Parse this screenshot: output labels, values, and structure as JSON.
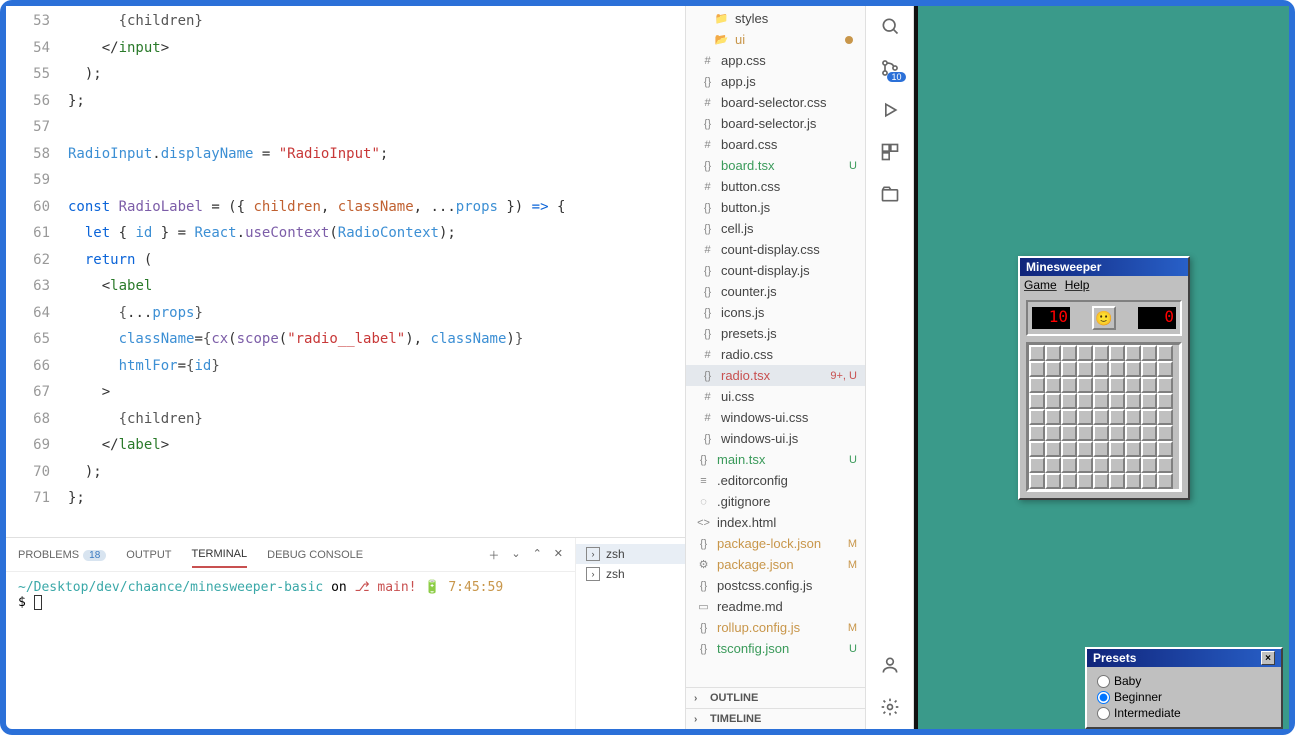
{
  "code": {
    "lines": [
      {
        "n": 53,
        "html": "      <span class='punc'>{children}</span>"
      },
      {
        "n": 54,
        "html": "    &lt;/<span class='tag'>input</span>&gt;"
      },
      {
        "n": 55,
        "html": "  );"
      },
      {
        "n": 56,
        "html": "};"
      },
      {
        "n": 57,
        "html": ""
      },
      {
        "n": 58,
        "html": "<span class='prop'>RadioInput</span>.<span class='prop'>displayName</span> = <span class='str'>\"RadioInput\"</span>;"
      },
      {
        "n": 59,
        "html": ""
      },
      {
        "n": 60,
        "html": "<span class='kw'>const</span> <span class='fn'>RadioLabel</span> = ({ <span class='param'>children</span>, <span class='param'>className</span>, ...<span class='prop'>props</span> }) <span class='kw'>=&gt;</span> {"
      },
      {
        "n": 61,
        "html": "  <span class='kw'>let</span> { <span class='prop'>id</span> } = <span class='prop'>React</span>.<span class='fn'>useContext</span>(<span class='prop'>RadioContext</span>);"
      },
      {
        "n": 62,
        "html": "  <span class='kw'>return</span> ("
      },
      {
        "n": 63,
        "html": "    &lt;<span class='tag'>label</span>"
      },
      {
        "n": 64,
        "html": "      <span class='punc'>{</span>...<span class='prop'>props</span><span class='punc'>}</span>"
      },
      {
        "n": 65,
        "html": "      <span class='prop'>className</span>=<span class='punc'>{</span><span class='fn'>cx</span>(<span class='fn'>scope</span>(<span class='str'>\"radio__label\"</span>), <span class='prop'>className</span>)<span class='punc'>}</span>"
      },
      {
        "n": 66,
        "html": "      <span class='prop'>htmlFor</span>=<span class='punc'>{</span><span class='prop'>id</span><span class='punc'>}</span>"
      },
      {
        "n": 67,
        "html": "    &gt;"
      },
      {
        "n": 68,
        "html": "      <span class='punc'>{children}</span>"
      },
      {
        "n": 69,
        "html": "    &lt;/<span class='tag'>label</span>&gt;"
      },
      {
        "n": 70,
        "html": "  );"
      },
      {
        "n": 71,
        "html": "};"
      }
    ]
  },
  "panel": {
    "tabs": {
      "problems": "PROBLEMS",
      "problems_count": "18",
      "output": "OUTPUT",
      "terminal": "TERMINAL",
      "debug": "DEBUG CONSOLE"
    },
    "terminal": {
      "path": "~/Desktop/dev/chaance/minesweeper-basic",
      "on": " on ",
      "branch": "⎇ main!",
      "battery": "🔋",
      "time": "7:45:59",
      "prompt": "$ "
    },
    "shells": [
      "zsh",
      "zsh"
    ]
  },
  "explorer": {
    "folders": {
      "styles": "styles",
      "ui": "ui"
    },
    "files": [
      {
        "name": "app.css",
        "icon": "#",
        "indent": 2
      },
      {
        "name": "app.js",
        "icon": "{}",
        "indent": 2
      },
      {
        "name": "board-selector.css",
        "icon": "#",
        "indent": 2
      },
      {
        "name": "board-selector.js",
        "icon": "{}",
        "indent": 2
      },
      {
        "name": "board.css",
        "icon": "#",
        "indent": 2
      },
      {
        "name": "board.tsx",
        "icon": "{}",
        "indent": 2,
        "cls": "green",
        "badge": "U"
      },
      {
        "name": "button.css",
        "icon": "#",
        "indent": 2
      },
      {
        "name": "button.js",
        "icon": "{}",
        "indent": 2
      },
      {
        "name": "cell.js",
        "icon": "{}",
        "indent": 2
      },
      {
        "name": "count-display.css",
        "icon": "#",
        "indent": 2
      },
      {
        "name": "count-display.js",
        "icon": "{}",
        "indent": 2
      },
      {
        "name": "counter.js",
        "icon": "{}",
        "indent": 2
      },
      {
        "name": "icons.js",
        "icon": "{}",
        "indent": 2
      },
      {
        "name": "presets.js",
        "icon": "{}",
        "indent": 2
      },
      {
        "name": "radio.css",
        "icon": "#",
        "indent": 2
      },
      {
        "name": "radio.tsx",
        "icon": "{}",
        "indent": 2,
        "cls": "red",
        "badge": "9+, U",
        "active": true
      },
      {
        "name": "ui.css",
        "icon": "#",
        "indent": 2
      },
      {
        "name": "windows-ui.css",
        "icon": "#",
        "indent": 2
      },
      {
        "name": "windows-ui.js",
        "icon": "{}",
        "indent": 2
      },
      {
        "name": "main.tsx",
        "icon": "{}",
        "indent": 1,
        "cls": "green",
        "badge": "U"
      },
      {
        "name": ".editorconfig",
        "icon": "≡",
        "indent": 1
      },
      {
        "name": ".gitignore",
        "icon": "◌",
        "indent": 1
      },
      {
        "name": "index.html",
        "icon": "<>",
        "indent": 1
      },
      {
        "name": "package-lock.json",
        "icon": "{}",
        "indent": 1,
        "cls": "orange",
        "badge": "M"
      },
      {
        "name": "package.json",
        "icon": "⚙",
        "indent": 1,
        "cls": "orange",
        "badge": "M"
      },
      {
        "name": "postcss.config.js",
        "icon": "{}",
        "indent": 1
      },
      {
        "name": "readme.md",
        "icon": "▭",
        "indent": 1
      },
      {
        "name": "rollup.config.js",
        "icon": "{}",
        "indent": 1,
        "cls": "orange",
        "badge": "M"
      },
      {
        "name": "tsconfig.json",
        "icon": "{}",
        "indent": 1,
        "cls": "green",
        "badge": "U"
      }
    ],
    "outline": "OUTLINE",
    "timeline": "TIMELINE"
  },
  "activity": {
    "scm_badge": "10"
  },
  "minesweeper": {
    "title": "Minesweeper",
    "menu_game": "Game",
    "menu_help": "Help",
    "mines": "10",
    "time": "0",
    "face": "🙂"
  },
  "presets": {
    "title": "Presets",
    "close": "×",
    "options": [
      {
        "label": "Baby",
        "checked": false
      },
      {
        "label": "Beginner",
        "checked": true
      },
      {
        "label": "Intermediate",
        "checked": false
      }
    ]
  }
}
